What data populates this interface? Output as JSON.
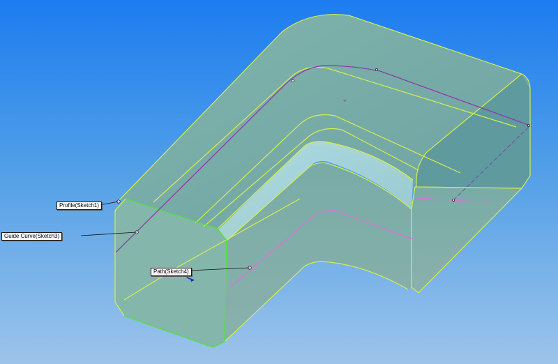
{
  "viewport": {
    "background_top": "#1c7cf0",
    "background_bottom": "#9dc4ea"
  },
  "model": {
    "face_color": "#6aa3a3",
    "edge_color": "#d6ef4a",
    "selected_edge_color": "#55e040",
    "guide_curve_color": "#8e3aa8",
    "path_color": "#e070d8"
  },
  "callouts": {
    "profile": "Profile(Sketch1)",
    "guide_curve": "Guide Curve(Sketch3)",
    "path": "Path(Sketch4)"
  },
  "icons": [
    "triad-axis-icon",
    "sketch-point-icon"
  ]
}
